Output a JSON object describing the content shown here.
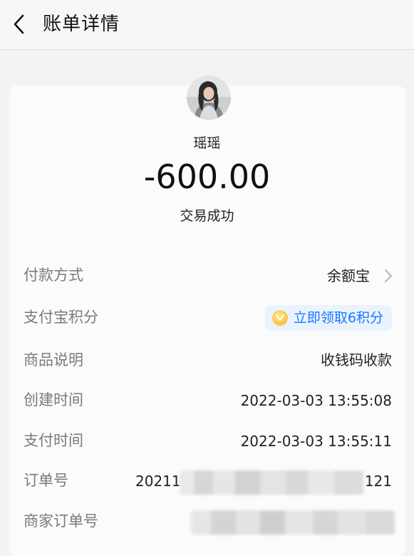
{
  "header": {
    "title": "账单详情"
  },
  "payee": {
    "name": "瑶瑶"
  },
  "transaction": {
    "amount": "-600.00",
    "status": "交易成功"
  },
  "details": {
    "payment_method": {
      "label": "付款方式",
      "value": "余额宝"
    },
    "points": {
      "label": "支付宝积分",
      "action": "立即领取6积分"
    },
    "description": {
      "label": "商品说明",
      "value": "收钱码收款"
    },
    "created": {
      "label": "创建时间",
      "value": "2022-03-03 13:55:08"
    },
    "paid": {
      "label": "支付时间",
      "value": "2022-03-03 13:55:11"
    },
    "order_no": {
      "label": "订单号",
      "prefix": "20211",
      "suffix": "121"
    },
    "merchant_order_no": {
      "label": "商家订单号"
    }
  },
  "icons": {
    "back": "chevron-left-icon",
    "payment_method_arrow": "chevron-right-icon",
    "points_coin": "coin-icon"
  },
  "colors": {
    "accent": "#1677ff",
    "pill_bg": "#eaf3fd",
    "coin": "#f3b71c"
  }
}
